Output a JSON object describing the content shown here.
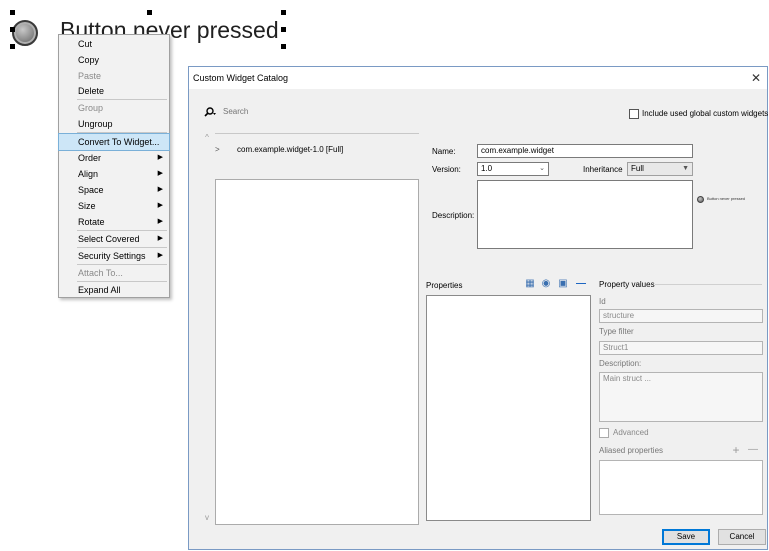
{
  "canvas": {
    "widget_label": "Button never pressed"
  },
  "context_menu": {
    "items": [
      {
        "label": "Cut",
        "disabled": false,
        "submenu": false
      },
      {
        "label": "Copy",
        "disabled": false,
        "submenu": false
      },
      {
        "label": "Paste",
        "disabled": true,
        "submenu": false
      },
      {
        "label": "Delete",
        "disabled": false,
        "submenu": false
      },
      {
        "label": "Group",
        "disabled": true,
        "submenu": false
      },
      {
        "label": "Ungroup",
        "disabled": false,
        "submenu": false
      },
      {
        "label": "Convert To Widget...",
        "disabled": false,
        "submenu": false,
        "highlighted": true
      },
      {
        "label": "Order",
        "disabled": false,
        "submenu": true
      },
      {
        "label": "Align",
        "disabled": false,
        "submenu": true
      },
      {
        "label": "Space",
        "disabled": false,
        "submenu": true
      },
      {
        "label": "Size",
        "disabled": false,
        "submenu": true
      },
      {
        "label": "Rotate",
        "disabled": false,
        "submenu": true
      },
      {
        "label": "Select Covered",
        "disabled": false,
        "submenu": true
      },
      {
        "label": "Security Settings",
        "disabled": false,
        "submenu": true
      },
      {
        "label": "Attach To...",
        "disabled": true,
        "submenu": false
      },
      {
        "label": "Expand All",
        "disabled": false,
        "submenu": false
      }
    ]
  },
  "dialog": {
    "title": "Custom Widget Catalog",
    "close_glyph": "✕",
    "search": {
      "icon": "search-icon",
      "placeholder": "Search",
      "value": ""
    },
    "include_global": {
      "label": "Include used global custom widgets",
      "checked": false
    },
    "tree": {
      "items": [
        {
          "chevron": ">",
          "label": "com.example.widget-1.0 [Full]"
        }
      ]
    },
    "name": {
      "label": "Name:",
      "value": "com.example.widget"
    },
    "version": {
      "label": "Version:",
      "value": "1.0"
    },
    "inheritance": {
      "label": "Inheritance",
      "value": "Full"
    },
    "description": {
      "label": "Description:",
      "value": ""
    },
    "preview_label": "Button never pressed",
    "properties": {
      "label": "Properties",
      "icons": [
        "add-property-icon",
        "add-group-icon",
        "import-property-icon",
        "remove-property-icon"
      ]
    },
    "property_values": {
      "title": "Property values",
      "id_label": "Id",
      "id_value": "structure",
      "type_filter_label": "Type filter",
      "type_filter_value": "Struct1",
      "description_label": "Description:",
      "description_value": "Main struct ...",
      "advanced_label": "Advanced",
      "aliased_label": "Aliased properties"
    },
    "buttons": {
      "save": "Save",
      "cancel": "Cancel"
    }
  },
  "colors": {
    "menu_highlight": "#cde6f7",
    "dialog_border": "#7a9ac4",
    "default_button_border": "#0078d7"
  }
}
